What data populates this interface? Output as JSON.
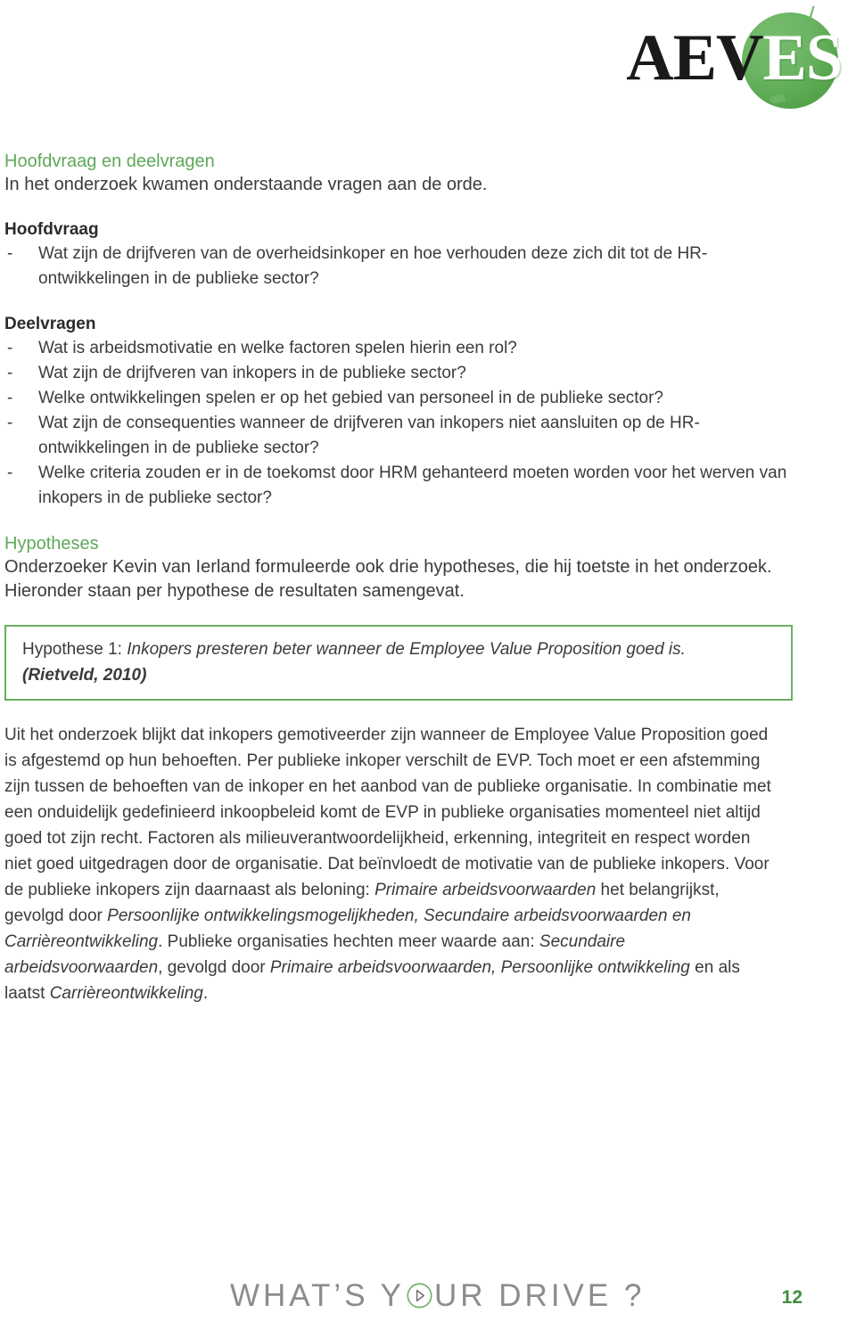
{
  "header": {
    "logo_text_dark": "AEV",
    "logo_text_light": "ES",
    "logo_alt": "AEVES"
  },
  "content": {
    "section_title": "Hoofdvraag en deelvragen",
    "lead_line": "In het onderzoek kwamen onderstaande vragen aan de orde.",
    "hoofdvraag_title": "Hoofdvraag",
    "hoofdvraag_items": [
      "Wat zijn de drijfveren van de overheidsinkoper en hoe verhouden deze zich dit tot de HR-ontwikkelingen in de publieke sector?"
    ],
    "deelvragen_title": "Deelvragen",
    "deelvragen_items": [
      "Wat is arbeidsmotivatie en welke factoren spelen hierin een rol?",
      "Wat zijn de drijfveren van inkopers in de publieke sector?",
      "Welke ontwikkelingen spelen er op het gebied van personeel in de publieke sector?",
      "Wat zijn de consequenties wanneer de drijfveren van inkopers niet aansluiten op de HR-ontwikkelingen in de publieke sector?",
      "Welke criteria zouden er in de toekomst door HRM gehanteerd moeten worden voor het werven van inkopers in de publieke sector?"
    ],
    "hypotheses_title": "Hypotheses",
    "hypotheses_intro": "Onderzoeker Kevin van Ierland formuleerde ook drie hypotheses, die hij toetste in het onderzoek. Hieronder staan per hypothese de resultaten samengevat.",
    "hypothesis_box": {
      "label": "Hypothese 1: ",
      "statement": "Inkopers presteren beter wanneer de Employee Value Proposition goed is.",
      "citation": "(Rietveld, 2010)"
    },
    "result_paragraph": {
      "part1": "Uit het onderzoek blijkt dat inkopers gemotiveerder zijn wanneer de Employee Value Proposition goed is afgestemd op hun behoeften. Per publieke inkoper verschilt de EVP. Toch moet er een afstemming zijn tussen de behoeften van de inkoper en het aanbod van de publieke organisatie. In combinatie met een onduidelijk gedefinieerd inkoopbeleid komt de EVP in publieke organisaties momenteel niet altijd goed tot zijn recht. Factoren als milieuverantwoordelijkheid, erkenning, integriteit en respect worden niet goed uitgedragen door de organisatie. Dat beïnvloedt de motivatie van de publieke inkopers. Voor de publieke inkopers zijn daarnaast als beloning: ",
      "em1": "Primaire arbeidsvoorwaarden",
      "part2": " het belangrijkst, gevolgd door ",
      "em2": "Persoonlijke ontwikkelingsmogelijkheden, Secundaire arbeidsvoorwaarden en Carrièreontwikkeling",
      "part3": ". Publieke organisaties hechten meer waarde aan: ",
      "em3": "Secundaire arbeidsvoorwaarden",
      "part4": ", gevolgd door ",
      "em4": "Primaire arbeidsvoorwaarden, Persoonlijke ontwikkeling",
      "part5": " en als laatst ",
      "em5": "Carrièreontwikkeling",
      "part6": "."
    }
  },
  "footer": {
    "tagline_before": "WHAT’S Y",
    "tagline_after": "UR DRIVE ?",
    "page_number": "12"
  },
  "colors": {
    "brand_green": "#5fa85a",
    "box_border_green": "#6aaf62",
    "page_number_green": "#3e8f3e",
    "tagline_gray": "#8c8c8c",
    "body_text": "#3b3b3b"
  }
}
